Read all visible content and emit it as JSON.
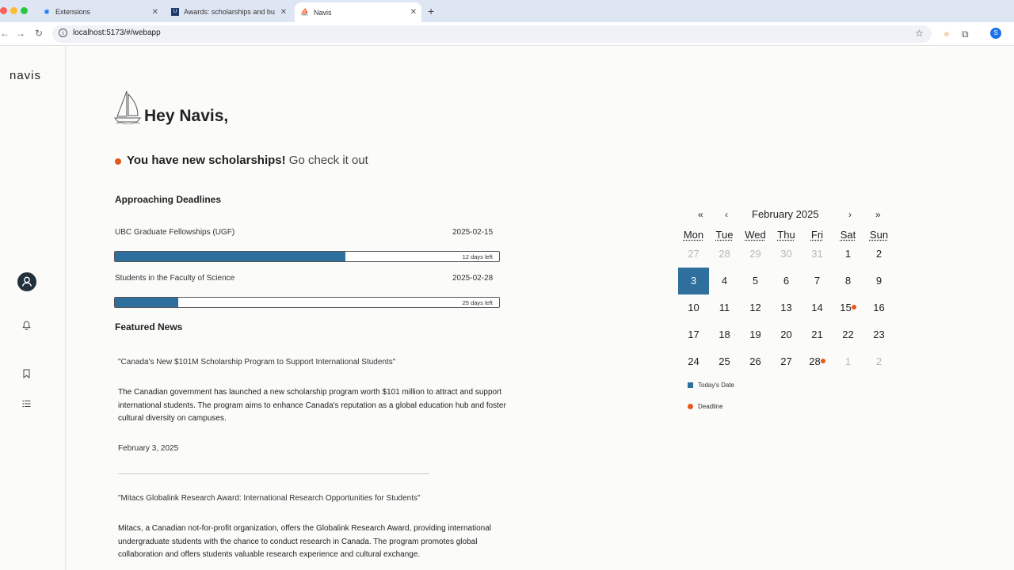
{
  "browser": {
    "tabs": [
      {
        "label": "Extensions"
      },
      {
        "label": "Awards: scholarships and bu"
      },
      {
        "label": "Navis"
      }
    ],
    "url": "localhost:5173/#/webapp",
    "profile_initial": "S"
  },
  "sidebar": {
    "brand": "navis"
  },
  "header": {
    "greeting": "Hey Navis,",
    "notice_bold": "You have new scholarships!",
    "notice_link": "Go check it out"
  },
  "deadlines": {
    "title": "Approaching Deadlines",
    "items": [
      {
        "name": "UBC Graduate Fellowships (UGF)",
        "date": "2025-02-15",
        "days_left": "12 days left",
        "progress": 0.6
      },
      {
        "name": "Students in the Faculty of Science",
        "date": "2025-02-28",
        "days_left": "25 days left",
        "progress": 0.165
      }
    ]
  },
  "news": {
    "title": "Featured News",
    "items": [
      {
        "headline": "\"Canada's New $101M Scholarship Program to Support International Students\"",
        "body": "The Canadian government has launched a new scholarship program worth $101 million to attract and support international students. The program aims to enhance Canada's reputation as a global education hub and foster cultural diversity on campuses.",
        "date": "February 3, 2025"
      },
      {
        "headline": "\"Mitacs Globalink Research Award: International Research Opportunities for Students\"",
        "body": "Mitacs, a Canadian not-for-profit organization, offers the Globalink Research Award, providing international undergraduate students with the chance to conduct research in Canada. The program promotes global collaboration and offers students valuable research experience and cultural exchange."
      }
    ]
  },
  "calendar": {
    "month_label": "February 2025",
    "nav": {
      "prev_year": "«",
      "prev_month": "‹",
      "next_month": "›",
      "next_year": "»"
    },
    "weekdays": [
      "Mon",
      "Tue",
      "Wed",
      "Thu",
      "Fri",
      "Sat",
      "Sun"
    ],
    "weeks": [
      [
        {
          "d": "27",
          "m": true
        },
        {
          "d": "28",
          "m": true
        },
        {
          "d": "29",
          "m": true
        },
        {
          "d": "30",
          "m": true
        },
        {
          "d": "31",
          "m": true
        },
        {
          "d": "1"
        },
        {
          "d": "2"
        }
      ],
      [
        {
          "d": "3",
          "today": true
        },
        {
          "d": "4"
        },
        {
          "d": "5"
        },
        {
          "d": "6"
        },
        {
          "d": "7"
        },
        {
          "d": "8"
        },
        {
          "d": "9"
        }
      ],
      [
        {
          "d": "10"
        },
        {
          "d": "11"
        },
        {
          "d": "12"
        },
        {
          "d": "13"
        },
        {
          "d": "14"
        },
        {
          "d": "15",
          "deadline": true
        },
        {
          "d": "16"
        }
      ],
      [
        {
          "d": "17"
        },
        {
          "d": "18"
        },
        {
          "d": "19"
        },
        {
          "d": "20"
        },
        {
          "d": "21"
        },
        {
          "d": "22"
        },
        {
          "d": "23"
        }
      ],
      [
        {
          "d": "24"
        },
        {
          "d": "25"
        },
        {
          "d": "26"
        },
        {
          "d": "27"
        },
        {
          "d": "28",
          "deadline": true
        },
        {
          "d": "1",
          "m": true
        },
        {
          "d": "2",
          "m": true
        }
      ]
    ],
    "legend": {
      "today": "Today's Date",
      "deadline": "Deadline"
    }
  },
  "colors": {
    "accent": "#2e6f9e",
    "deadline_dot": "#e55a1c"
  }
}
